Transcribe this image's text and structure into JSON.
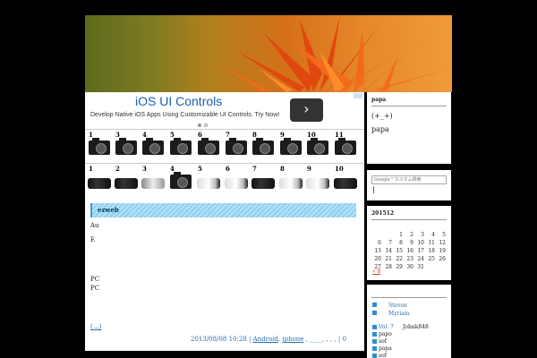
{
  "ad": {
    "title": "iOS UI Controls",
    "description": "Develop Native iOS Apps Using Customizable UI Controls. Try Now!",
    "arrow": "›"
  },
  "rankings": {
    "row1_numbers": [
      "1",
      "3",
      "4",
      "5",
      "6",
      "7",
      "8",
      "9",
      "10",
      "11"
    ],
    "row2_numbers": [
      "1",
      "2",
      "3",
      "4",
      "5",
      "6",
      "7",
      "8",
      "9",
      "10"
    ]
  },
  "post": {
    "section_title": "ezweb",
    "lines": [
      {
        "text": "Au"
      },
      {
        "text": "E"
      },
      {
        "text": "PC"
      },
      {
        "text": "PC"
      }
    ],
    "more_link": "(…)",
    "date": "2013/08/08 10:28 |",
    "tag1": "Android",
    "tag2": "iphone",
    "tag_rest": ", ____, , , , | 0"
  },
  "sidebar": {
    "profile": {
      "heading": "papa",
      "line1": "(+_+)",
      "line2": "papa"
    },
    "search": {
      "placeholder": "Google™カスタム検索"
    },
    "calendar": {
      "heading": "201512",
      "weeks": [
        [
          "",
          "",
          "1",
          "2",
          "3",
          "4",
          "5"
        ],
        [
          "6",
          "7",
          "8",
          "9",
          "10",
          "11",
          "12"
        ],
        [
          "13",
          "14",
          "15",
          "16",
          "17",
          "18",
          "19"
        ],
        [
          "20",
          "21",
          "22",
          "23",
          "24",
          "25",
          "26"
        ],
        [
          "27",
          "28",
          "29",
          "30",
          "31",
          "",
          ""
        ]
      ],
      "prev": "« 8"
    },
    "links": {
      "name1": "Steven",
      "name2": "Myriam",
      "vol": "Vol. 7",
      "john": "Johnk848",
      "items": [
        "papo",
        "sof",
        "papa",
        "sof"
      ]
    }
  },
  "colors": {
    "accent": "#2a6fb0",
    "section_bar": "#8fd0ef"
  }
}
